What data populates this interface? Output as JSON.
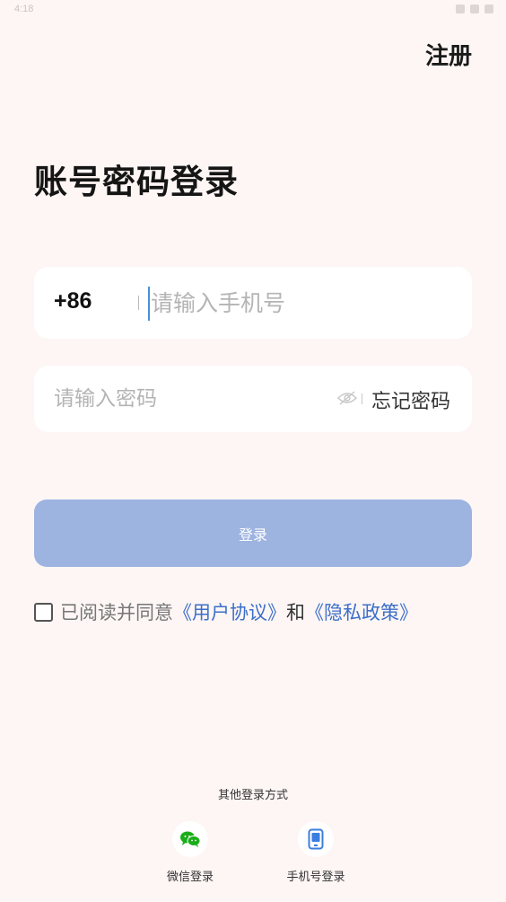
{
  "status_bar": {
    "time": "4:18"
  },
  "header": {
    "register_label": "注册"
  },
  "title": "账号密码登录",
  "phone": {
    "country_code": "+86",
    "placeholder": "请输入手机号"
  },
  "password": {
    "placeholder": "请输入密码",
    "forgot_label": "忘记密码"
  },
  "login_button": {
    "label": "登录"
  },
  "agreement": {
    "prefix": "已阅读并同意",
    "user_agreement": "《用户协议》",
    "and": "和",
    "privacy_policy": "《隐私政策》"
  },
  "other_login": {
    "title": "其他登录方式",
    "wechat_label": "微信登录",
    "wechat_icon": "wechat-icon",
    "phone_label": "手机号登录",
    "phone_icon": "mobile-phone-icon"
  },
  "colors": {
    "background": "#fdf6f5",
    "button": "#9db3e0",
    "link": "#3d6fc9",
    "wechat_green": "#1aad19",
    "phone_blue": "#3a7fe0"
  }
}
